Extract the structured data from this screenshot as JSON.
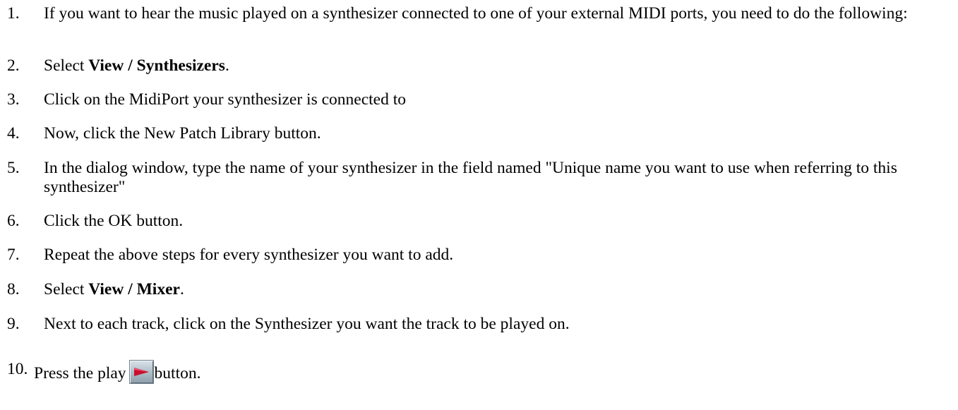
{
  "steps": [
    {
      "number": "1.",
      "text": "If you want to hear the music played on a synthesizer connected to one of your external MIDI ports, you need to do the following:"
    },
    {
      "number": "2.",
      "prefix": "Select ",
      "bold": "View / Synthesizers",
      "suffix": "."
    },
    {
      "number": "3.",
      "text": "Click on the MidiPort your synthesizer is connected to"
    },
    {
      "number": "4.",
      "text": "Now, click the New Patch Library button."
    },
    {
      "number": "5.",
      "text": "In the dialog window, type the name of your synthesizer in the field named \"Unique name you want to use when referring to this synthesizer\""
    },
    {
      "number": "6.",
      "text": "Click the OK button."
    },
    {
      "number": "7.",
      "text": "Repeat the above steps for every synthesizer you want to add."
    },
    {
      "number": "8.",
      "prefix": "Select ",
      "bold": "View / Mixer",
      "suffix": "."
    },
    {
      "number": "9.",
      "text": "Next to each track, click on the Synthesizer you want the track to be played on."
    },
    {
      "number": "10.",
      "prefix": "Press the play",
      "icon": "play-icon",
      "suffix": "button."
    }
  ],
  "colors": {
    "text": "#000000",
    "background": "#ffffff",
    "play_icon": "#c8102e"
  }
}
